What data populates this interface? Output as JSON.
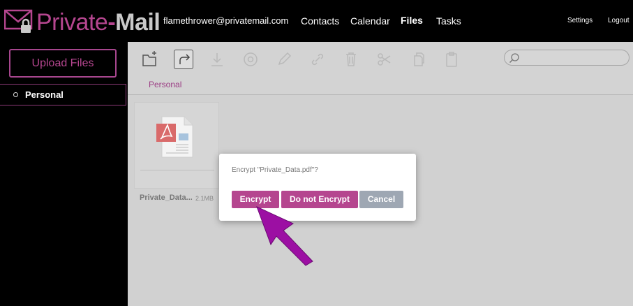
{
  "header": {
    "logo_part1": "Private",
    "logo_dash": "-",
    "logo_part2": "Mail",
    "account": "flamethrower@privatemail.com",
    "nav": {
      "contacts": "Contacts",
      "calendar": "Calendar",
      "files": "Files",
      "tasks": "Tasks",
      "settings": "Settings",
      "logout": "Logout"
    }
  },
  "sidebar": {
    "upload_label": "Upload Files",
    "folders": [
      {
        "label": "Personal"
      }
    ]
  },
  "toolbar": {
    "icons": [
      "new-folder-icon",
      "share-icon",
      "download-icon",
      "email-icon",
      "rename-icon",
      "link-icon",
      "delete-icon",
      "cut-icon",
      "copy-icon",
      "paste-icon"
    ],
    "search_placeholder": ""
  },
  "breadcrumb": "Personal",
  "files": [
    {
      "name": "Private_Data...",
      "size": "2.1MB",
      "icon": "pdf-file-icon"
    }
  ],
  "dialog": {
    "message": "Encrypt \"Private_Data.pdf\"?",
    "buttons": {
      "encrypt": "Encrypt",
      "no_encrypt": "Do not Encrypt",
      "cancel": "Cancel"
    }
  },
  "colors": {
    "accent": "#b5468f",
    "arrow": "#9c0fa3",
    "cancel": "#9ea7b3",
    "main_bg": "#d1d1d1"
  }
}
